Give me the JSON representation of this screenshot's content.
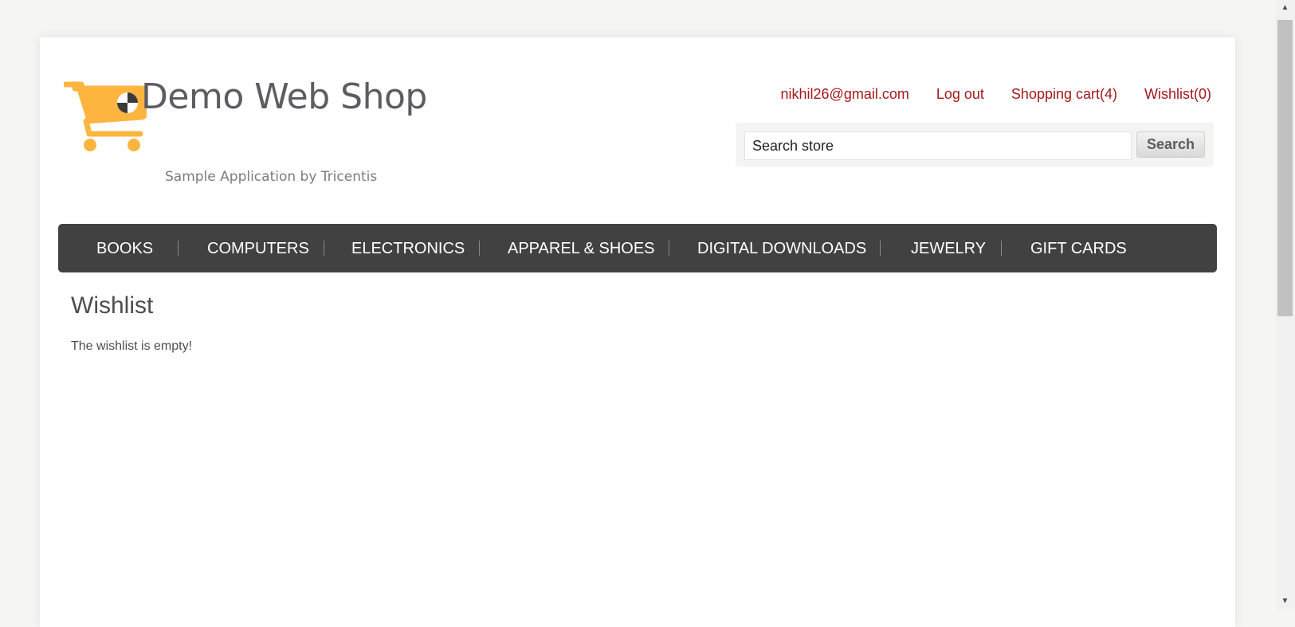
{
  "brand": {
    "title": "Demo Web Shop",
    "subtitle": "Sample Application by Tricentis",
    "logo_icon": "shopping-cart-icon",
    "accent_color": "#fdb53f"
  },
  "header": {
    "account_email": "nikhil26@gmail.com",
    "logout_label": "Log out",
    "cart_label": "Shopping cart(4)",
    "wishlist_label": "Wishlist(0)"
  },
  "search": {
    "placeholder": "Search store",
    "button_label": "Search"
  },
  "nav": {
    "items": [
      {
        "label": "BOOKS"
      },
      {
        "label": "COMPUTERS"
      },
      {
        "label": "ELECTRONICS"
      },
      {
        "label": "APPAREL & SHOES"
      },
      {
        "label": "DIGITAL DOWNLOADS"
      },
      {
        "label": "JEWELRY"
      },
      {
        "label": "GIFT CARDS"
      }
    ]
  },
  "content": {
    "title": "Wishlist",
    "message": "The wishlist is empty!"
  },
  "colors": {
    "link": "#a2191b",
    "nav_bg": "#414141",
    "text": "#4d4d4f"
  }
}
